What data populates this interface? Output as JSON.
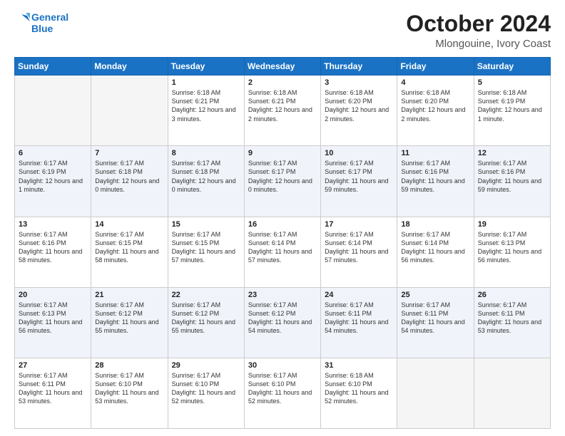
{
  "logo": {
    "line1": "General",
    "line2": "Blue"
  },
  "title": "October 2024",
  "subtitle": "Mlongouine, Ivory Coast",
  "days_of_week": [
    "Sunday",
    "Monday",
    "Tuesday",
    "Wednesday",
    "Thursday",
    "Friday",
    "Saturday"
  ],
  "weeks": [
    [
      {
        "day": "",
        "info": ""
      },
      {
        "day": "",
        "info": ""
      },
      {
        "day": "1",
        "info": "Sunrise: 6:18 AM\nSunset: 6:21 PM\nDaylight: 12 hours and 3 minutes."
      },
      {
        "day": "2",
        "info": "Sunrise: 6:18 AM\nSunset: 6:21 PM\nDaylight: 12 hours and 2 minutes."
      },
      {
        "day": "3",
        "info": "Sunrise: 6:18 AM\nSunset: 6:20 PM\nDaylight: 12 hours and 2 minutes."
      },
      {
        "day": "4",
        "info": "Sunrise: 6:18 AM\nSunset: 6:20 PM\nDaylight: 12 hours and 2 minutes."
      },
      {
        "day": "5",
        "info": "Sunrise: 6:18 AM\nSunset: 6:19 PM\nDaylight: 12 hours and 1 minute."
      }
    ],
    [
      {
        "day": "6",
        "info": "Sunrise: 6:17 AM\nSunset: 6:19 PM\nDaylight: 12 hours and 1 minute."
      },
      {
        "day": "7",
        "info": "Sunrise: 6:17 AM\nSunset: 6:18 PM\nDaylight: 12 hours and 0 minutes."
      },
      {
        "day": "8",
        "info": "Sunrise: 6:17 AM\nSunset: 6:18 PM\nDaylight: 12 hours and 0 minutes."
      },
      {
        "day": "9",
        "info": "Sunrise: 6:17 AM\nSunset: 6:17 PM\nDaylight: 12 hours and 0 minutes."
      },
      {
        "day": "10",
        "info": "Sunrise: 6:17 AM\nSunset: 6:17 PM\nDaylight: 11 hours and 59 minutes."
      },
      {
        "day": "11",
        "info": "Sunrise: 6:17 AM\nSunset: 6:16 PM\nDaylight: 11 hours and 59 minutes."
      },
      {
        "day": "12",
        "info": "Sunrise: 6:17 AM\nSunset: 6:16 PM\nDaylight: 11 hours and 59 minutes."
      }
    ],
    [
      {
        "day": "13",
        "info": "Sunrise: 6:17 AM\nSunset: 6:16 PM\nDaylight: 11 hours and 58 minutes."
      },
      {
        "day": "14",
        "info": "Sunrise: 6:17 AM\nSunset: 6:15 PM\nDaylight: 11 hours and 58 minutes."
      },
      {
        "day": "15",
        "info": "Sunrise: 6:17 AM\nSunset: 6:15 PM\nDaylight: 11 hours and 57 minutes."
      },
      {
        "day": "16",
        "info": "Sunrise: 6:17 AM\nSunset: 6:14 PM\nDaylight: 11 hours and 57 minutes."
      },
      {
        "day": "17",
        "info": "Sunrise: 6:17 AM\nSunset: 6:14 PM\nDaylight: 11 hours and 57 minutes."
      },
      {
        "day": "18",
        "info": "Sunrise: 6:17 AM\nSunset: 6:14 PM\nDaylight: 11 hours and 56 minutes."
      },
      {
        "day": "19",
        "info": "Sunrise: 6:17 AM\nSunset: 6:13 PM\nDaylight: 11 hours and 56 minutes."
      }
    ],
    [
      {
        "day": "20",
        "info": "Sunrise: 6:17 AM\nSunset: 6:13 PM\nDaylight: 11 hours and 56 minutes."
      },
      {
        "day": "21",
        "info": "Sunrise: 6:17 AM\nSunset: 6:12 PM\nDaylight: 11 hours and 55 minutes."
      },
      {
        "day": "22",
        "info": "Sunrise: 6:17 AM\nSunset: 6:12 PM\nDaylight: 11 hours and 55 minutes."
      },
      {
        "day": "23",
        "info": "Sunrise: 6:17 AM\nSunset: 6:12 PM\nDaylight: 11 hours and 54 minutes."
      },
      {
        "day": "24",
        "info": "Sunrise: 6:17 AM\nSunset: 6:11 PM\nDaylight: 11 hours and 54 minutes."
      },
      {
        "day": "25",
        "info": "Sunrise: 6:17 AM\nSunset: 6:11 PM\nDaylight: 11 hours and 54 minutes."
      },
      {
        "day": "26",
        "info": "Sunrise: 6:17 AM\nSunset: 6:11 PM\nDaylight: 11 hours and 53 minutes."
      }
    ],
    [
      {
        "day": "27",
        "info": "Sunrise: 6:17 AM\nSunset: 6:11 PM\nDaylight: 11 hours and 53 minutes."
      },
      {
        "day": "28",
        "info": "Sunrise: 6:17 AM\nSunset: 6:10 PM\nDaylight: 11 hours and 53 minutes."
      },
      {
        "day": "29",
        "info": "Sunrise: 6:17 AM\nSunset: 6:10 PM\nDaylight: 11 hours and 52 minutes."
      },
      {
        "day": "30",
        "info": "Sunrise: 6:17 AM\nSunset: 6:10 PM\nDaylight: 11 hours and 52 minutes."
      },
      {
        "day": "31",
        "info": "Sunrise: 6:18 AM\nSunset: 6:10 PM\nDaylight: 11 hours and 52 minutes."
      },
      {
        "day": "",
        "info": ""
      },
      {
        "day": "",
        "info": ""
      }
    ]
  ]
}
